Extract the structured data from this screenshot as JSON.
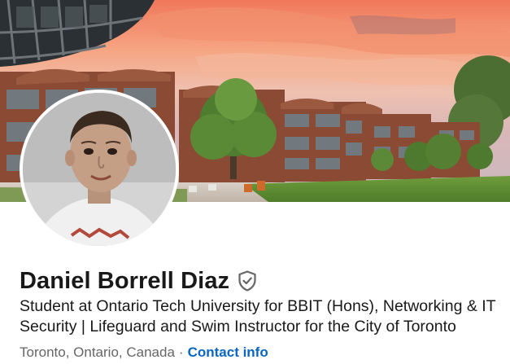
{
  "profile": {
    "name": "Daniel Borrell Diaz",
    "headline": "Student at Ontario Tech University for BBIT (Hons), Networking & IT Security | Lifeguard and Swim Instructor for the City of Toronto",
    "location": "Toronto, Ontario, Canada",
    "separator": "·",
    "contact_link": "Contact info"
  },
  "icons": {
    "verify": "shield-check-icon"
  },
  "colors": {
    "name_text": "#191919",
    "secondary_text": "#666666",
    "link": "#0a66c2",
    "badge": "#666666"
  }
}
